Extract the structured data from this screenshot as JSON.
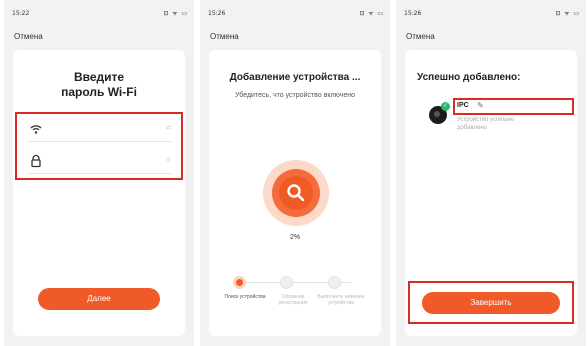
{
  "colors": {
    "accent": "#f05a28",
    "highlight": "#d72c24",
    "success": "#2bb673"
  },
  "screen1": {
    "time": "15:22",
    "status_icons": "⊡ ᯤ ▭",
    "cancel": "Отмена",
    "title": "Введите пароль Wi-Fi",
    "wifi_field_icon": "wifi-icon",
    "wifi_hint": "⇄",
    "password_icon": "lock-icon",
    "password_hint": "◎",
    "next_button": "Далее"
  },
  "screen2": {
    "time": "15:26",
    "status_icons": "⊡ ᯤ ▭",
    "cancel": "Отмена",
    "title": "Добавление устройства ...",
    "subtitle": "Убедитесь, что устройство включено",
    "progress_percent": 2,
    "progress_label": "2%",
    "steps": [
      {
        "label": "Поиск устройства",
        "state": "active"
      },
      {
        "label": "Облачная регистрация",
        "state": "pending"
      },
      {
        "label": "Выполните нижение устройства",
        "state": "pending"
      }
    ]
  },
  "screen3": {
    "time": "15:26",
    "status_icons": "⊡ ᯤ ▭",
    "cancel": "Отмена",
    "title": "Успешно добавлено:",
    "device_name": "IPC",
    "device_status": "Устройство успешно добавлено",
    "finish_button": "Завершить"
  }
}
